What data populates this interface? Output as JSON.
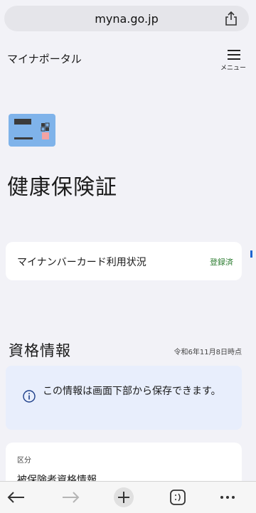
{
  "browser": {
    "url": "myna.go.jp"
  },
  "header": {
    "site_title": "マイナポータル",
    "menu_label": "メニュー"
  },
  "page": {
    "title": "健康保険証"
  },
  "status_card": {
    "label": "マイナンバーカード利用状況",
    "status": "登録済",
    "status_color": "#2e7d32"
  },
  "qualification": {
    "title": "資格情報",
    "as_of": "令和6年11月8日時点",
    "notice": "この情報は画面下部から保存できます。",
    "field_label": "区分",
    "field_value": "被保険者資格情報"
  },
  "toolbar": {
    "icons": [
      "back-arrow-icon",
      "forward-arrow-icon",
      "new-tab-plus-icon",
      "tabs-icon",
      "more-icon"
    ]
  },
  "colors": {
    "accent": "#1e66d0",
    "card_blue": "#7fb3ea",
    "info_bg": "#e8eefc"
  }
}
